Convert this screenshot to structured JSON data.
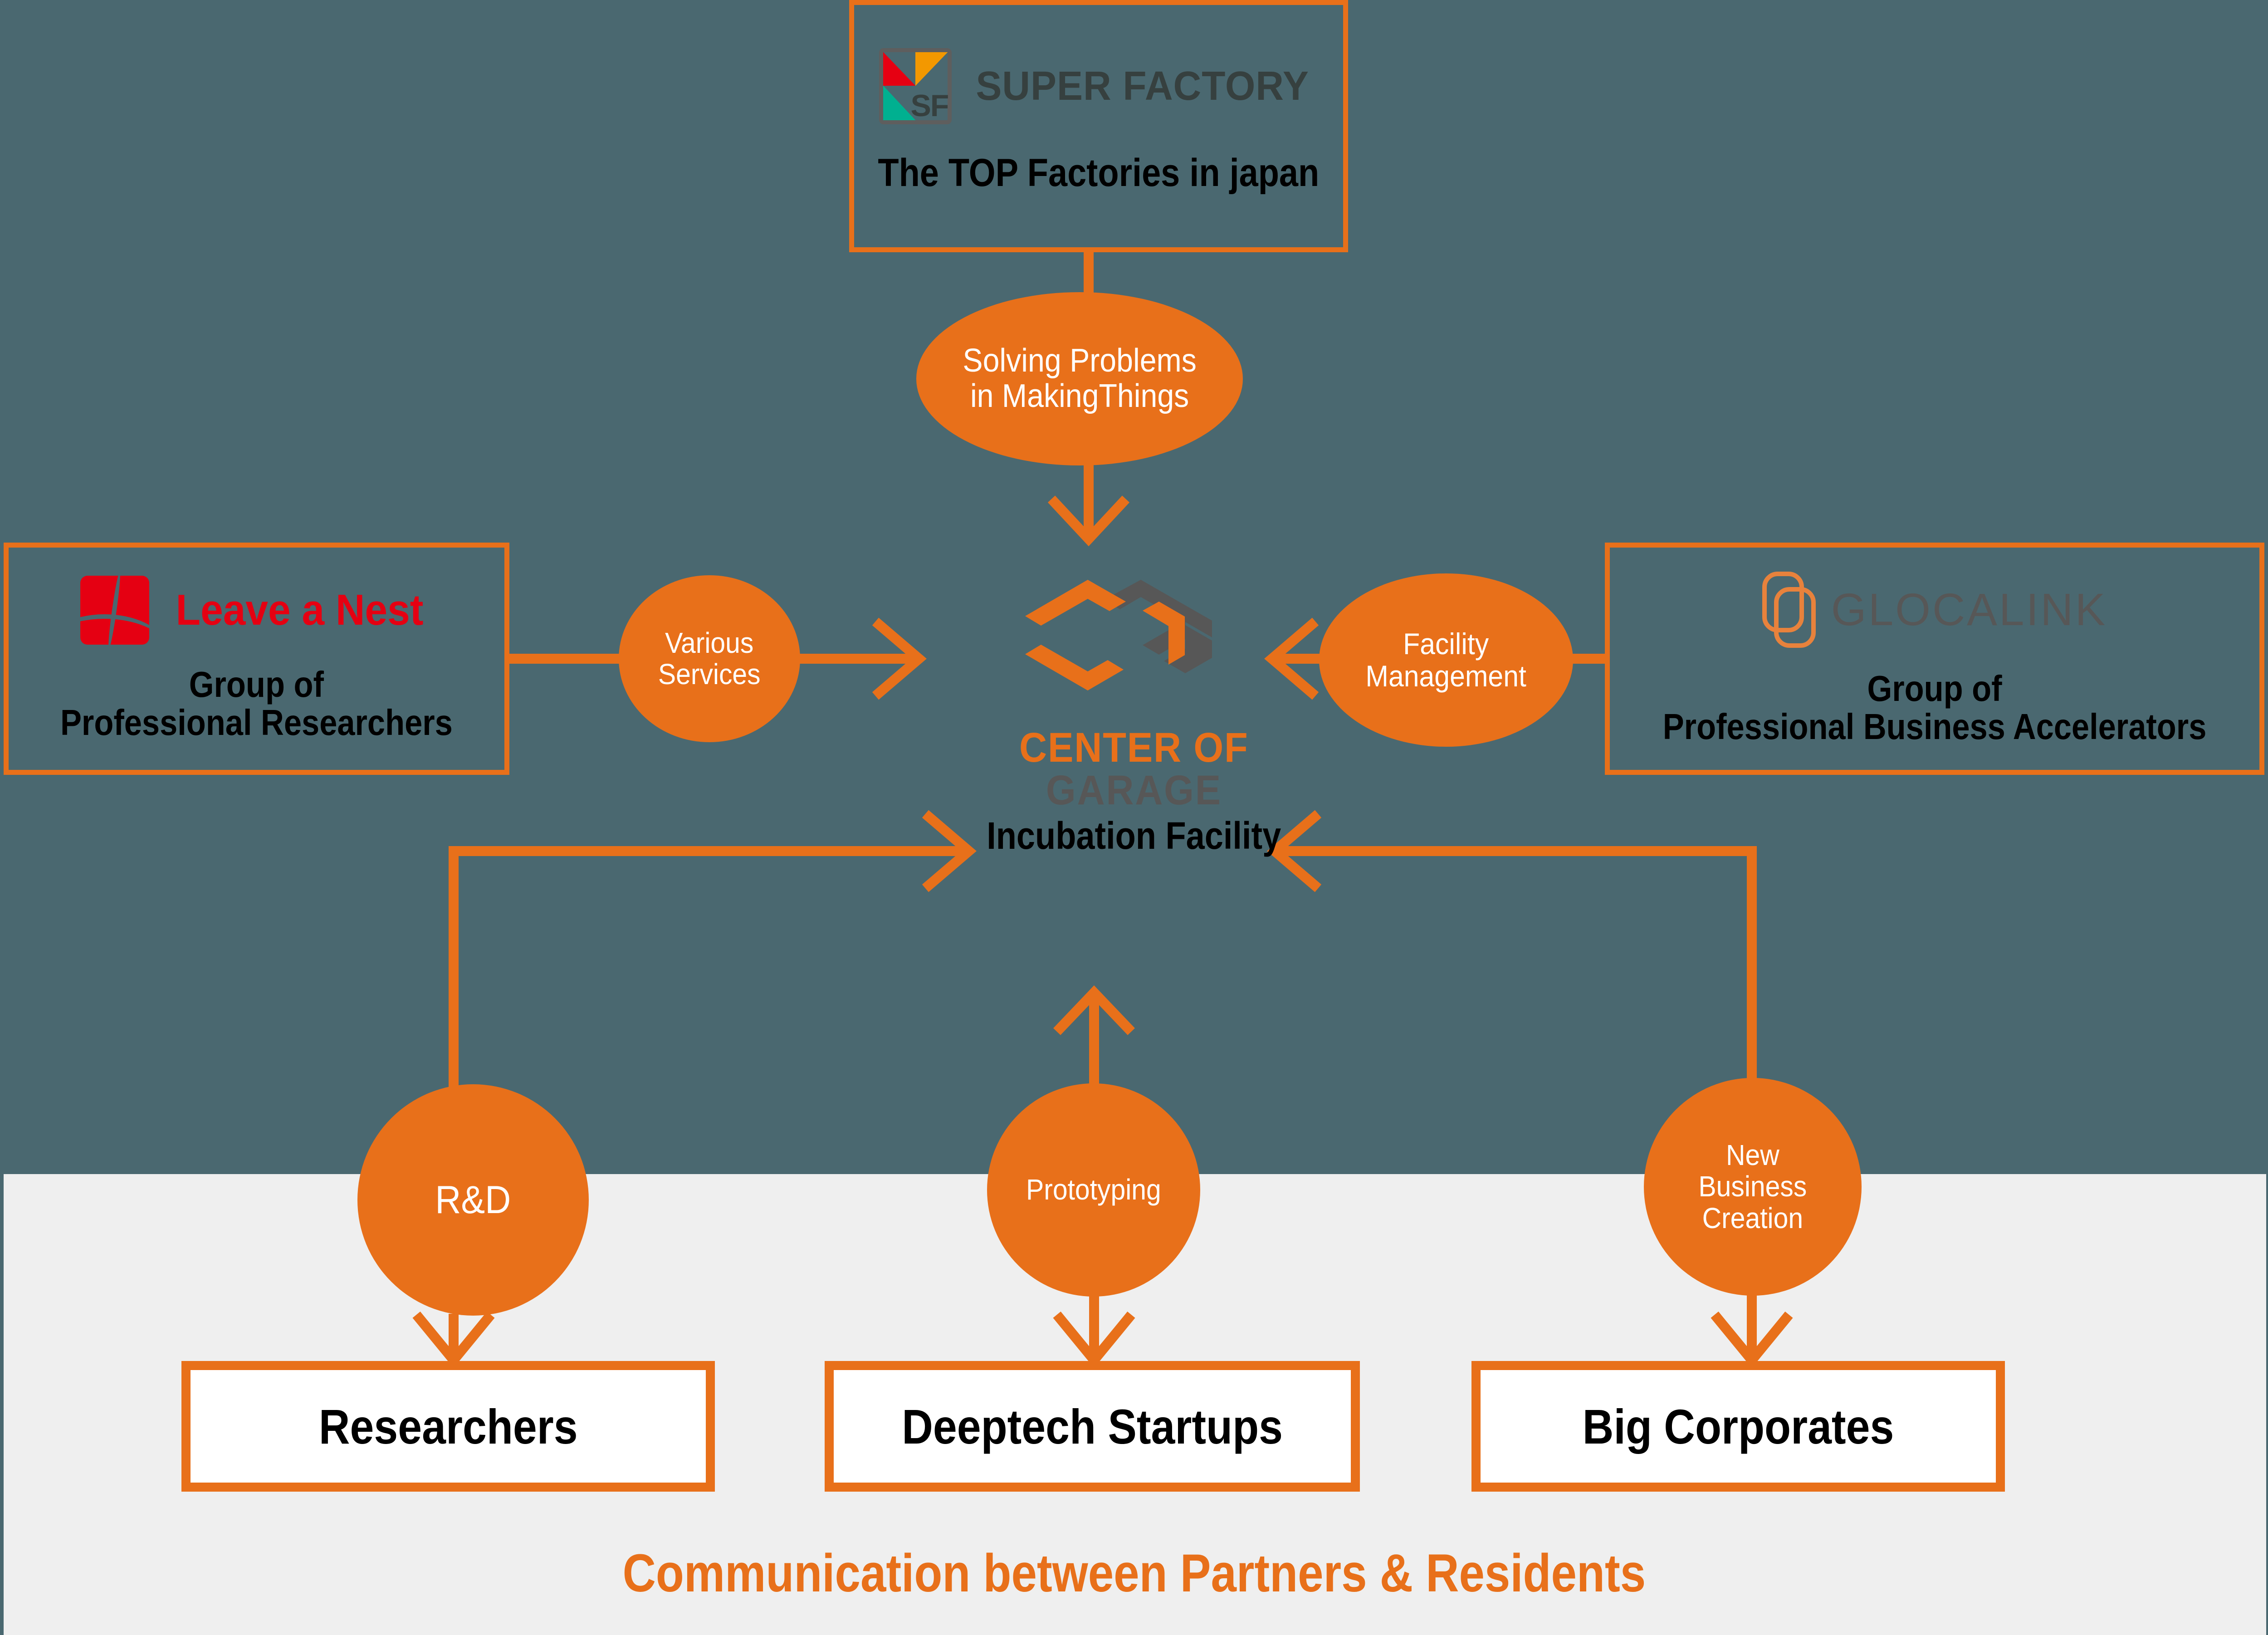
{
  "colors": {
    "background_dark": "#4A6870",
    "panel_light": "#EFEFEF",
    "accent_orange": "#E8701A",
    "logo_gray": "#575757",
    "leave_a_nest_red": "#E50012",
    "sf_red": "#E60012",
    "sf_orange": "#F39800",
    "sf_teal": "#00B090",
    "box_white": "#FFFFFF",
    "text_black": "#000000"
  },
  "partners": {
    "super_factory": {
      "logo_mark": "sf-logo-icon",
      "logo_letters": "SF",
      "name": "SUPER FACTORY",
      "caption": "The TOP Factories in japan"
    },
    "leave_a_nest": {
      "logo_mark": "leave-a-nest-logo-icon",
      "name": "Leave a Nest",
      "caption_line1": "Group of",
      "caption_line2": "Professional Researchers"
    },
    "glocalink": {
      "logo_mark": "glocalink-logo-icon",
      "name": "GLOCALINK",
      "caption_line1": "Group of",
      "caption_line2": "Professional Business Accelerators"
    }
  },
  "center": {
    "logo_mark": "center-of-garage-logo-icon",
    "title_line1": "CENTER OF",
    "title_line2": "GARAGE",
    "subtitle": "Incubation Facility"
  },
  "relations": {
    "solving_problems": {
      "line1": "Solving Problems",
      "line2": "in MakingThings"
    },
    "various_services": {
      "line1": "Various",
      "line2": "Services"
    },
    "facility_management": {
      "line1": "Facility",
      "line2": "Management"
    },
    "rd": {
      "line1": "R&D"
    },
    "prototyping": {
      "line1": "Prototyping"
    },
    "new_business_creation": {
      "line1": "New",
      "line2": "Business",
      "line3": "Creation"
    }
  },
  "residents": [
    {
      "label": "Researchers"
    },
    {
      "label": "Deeptech Startups"
    },
    {
      "label": "Big Corporates"
    }
  ],
  "footer": {
    "caption": "Communication between Partners & Residents"
  }
}
